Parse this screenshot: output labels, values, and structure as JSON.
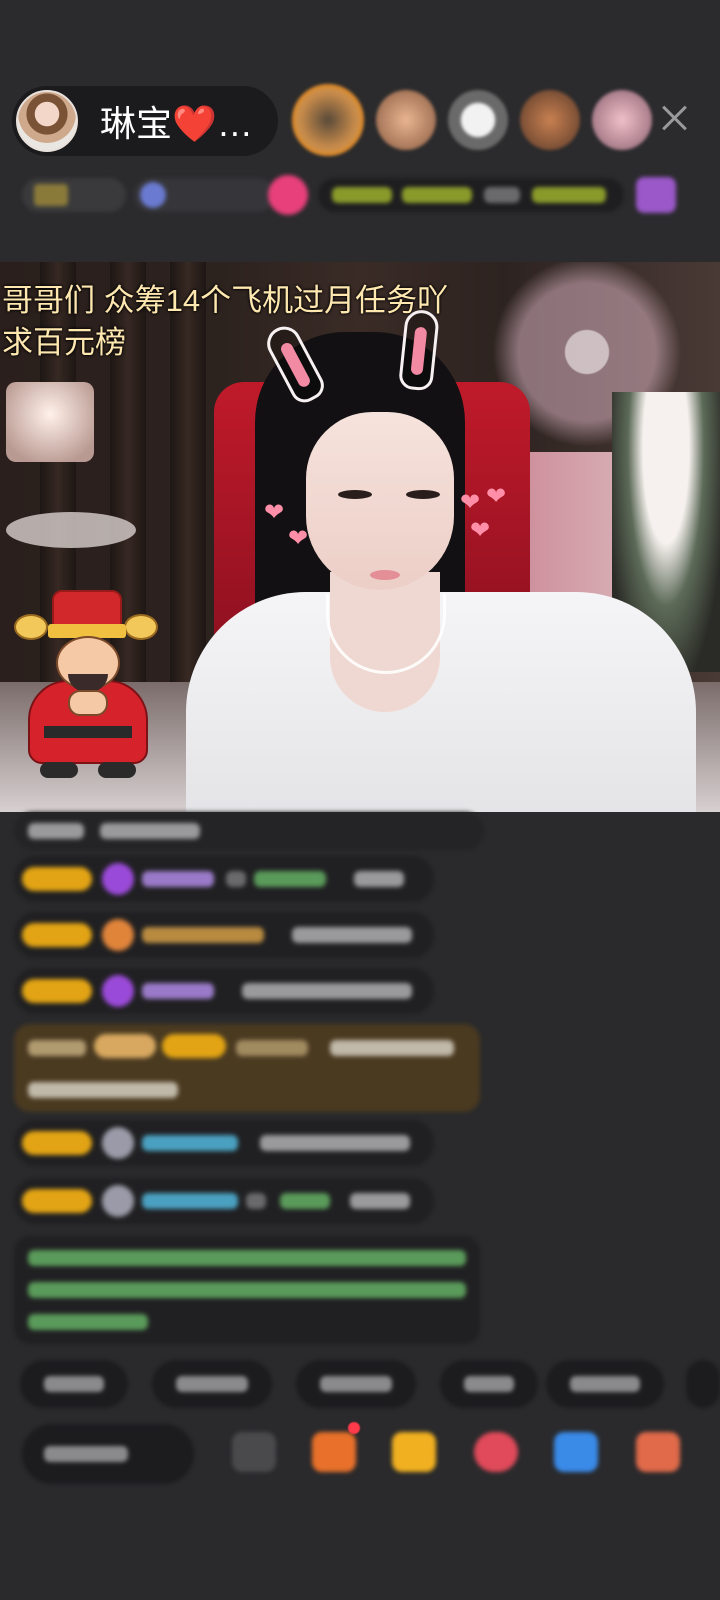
{
  "host": {
    "name": "琳宝❤️…"
  },
  "video": {
    "caption": "哥哥们 众筹14个飞机过月任务吖\n求百元榜"
  },
  "colors": {
    "background": "#2a2a2c",
    "gift_gold": "#e2a414",
    "caption": "#ffe8b0"
  }
}
